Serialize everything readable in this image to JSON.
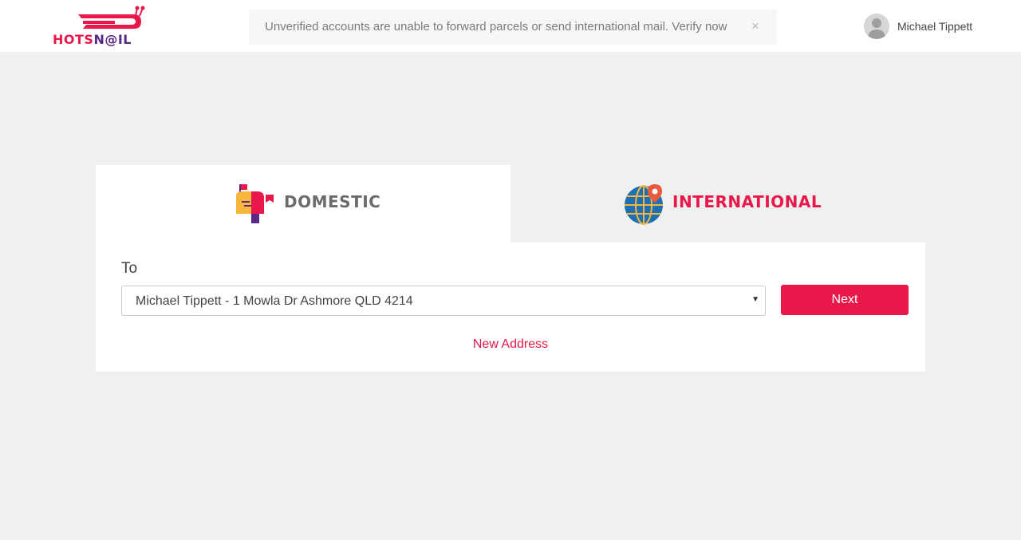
{
  "header": {
    "logo": {
      "part1": "HOTS",
      "part2": "N@IL"
    },
    "notice": {
      "text": "Unverified accounts are unable to forward parcels or send international mail. Verify now",
      "close_symbol": "×"
    },
    "user": {
      "name": "Michael Tippett",
      "avatar_icon": "user-avatar-icon"
    }
  },
  "tabs": [
    {
      "label": "DOMESTIC",
      "icon": "mailbox-icon",
      "active": true
    },
    {
      "label": "INTERNATIONAL",
      "icon": "globe-pin-icon",
      "active": false
    }
  ],
  "form": {
    "to_label": "To",
    "address_selected": "Michael Tippett - 1 Mowla Dr Ashmore QLD 4214",
    "caret": "▼",
    "next_label": "Next",
    "new_address_label": "New Address"
  },
  "colors": {
    "brand_red": "#e8194a",
    "brand_purple": "#5b2a86",
    "background": "#f0f0f0"
  }
}
